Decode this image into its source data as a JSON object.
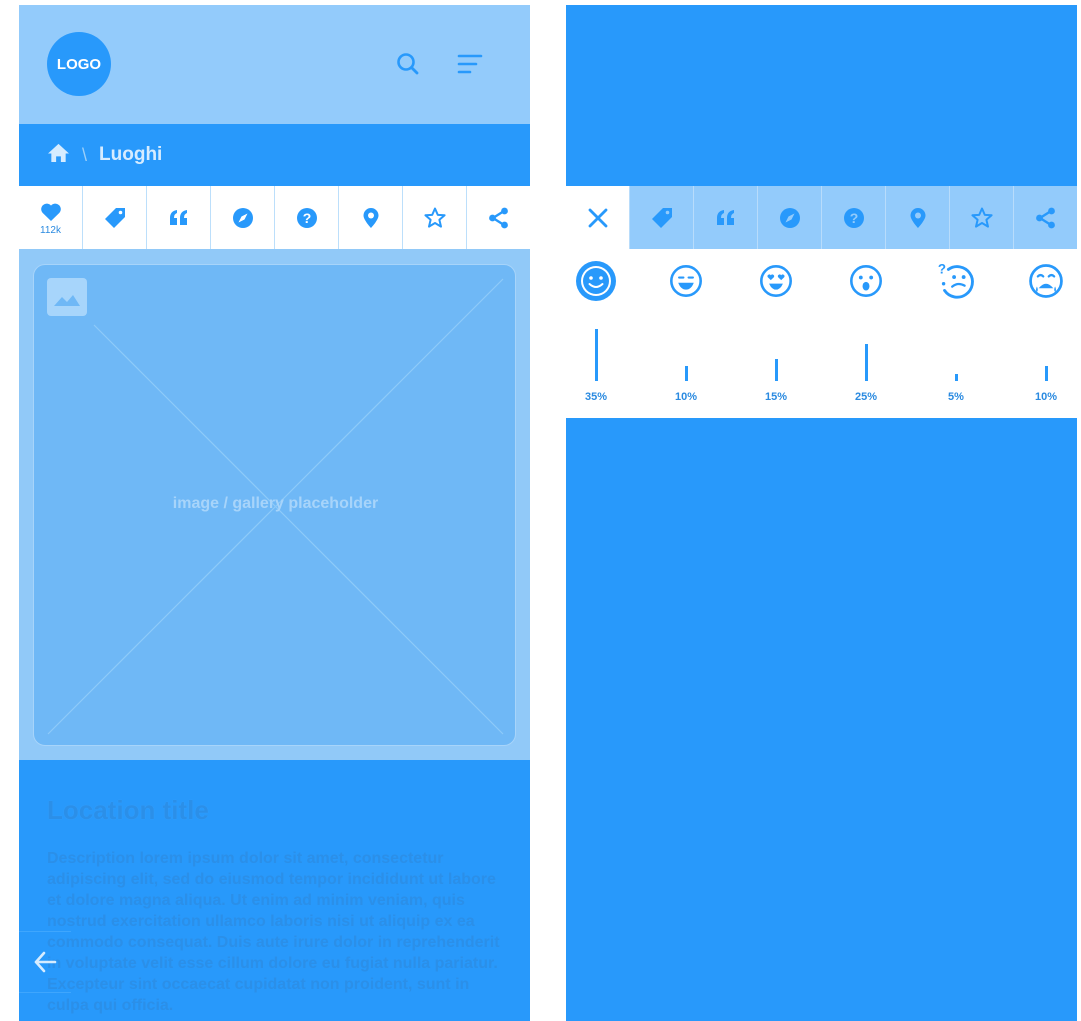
{
  "colors": {
    "brand": "#2899fb",
    "light": "#93cbfb",
    "placeholder": "#6fb8f6",
    "white": "#ffffff"
  },
  "header": {
    "logo_text": "LOGO",
    "icons": [
      "search-icon",
      "menu-icon"
    ]
  },
  "breadcrumb": {
    "home_icon": "home-icon",
    "separator": "\\",
    "current": "Luoghi"
  },
  "tabs": {
    "items": [
      {
        "icon": "heart-icon",
        "count": "112k"
      },
      {
        "icon": "tag-icon"
      },
      {
        "icon": "quote-icon"
      },
      {
        "icon": "compass-icon"
      },
      {
        "icon": "question-icon"
      },
      {
        "icon": "location-pin-icon"
      },
      {
        "icon": "star-icon"
      },
      {
        "icon": "share-icon"
      }
    ]
  },
  "gallery": {
    "label": "image / gallery placeholder",
    "icon": "image-icon"
  },
  "location": {
    "title": "Location title",
    "description": "Description lorem ipsum dolor sit amet, consectetur adipiscing elit, sed do eiusmod tempor incididunt ut labore et dolore magna aliqua. Ut enim ad minim veniam, quis nostrud exercitation ullamco laboris nisi ut aliquip ex ea commodo consequat. Duis aute irure dolor in reprehenderit in voluptate velit esse cillum dolore eu fugiat nulla pariatur. Excepteur sint occaecat cupidatat non proident, sunt in culpa qui officia."
  },
  "back_button": {
    "icon": "arrow-left-icon"
  },
  "reactions_panel": {
    "tabs": [
      "close-icon",
      "tag-icon",
      "quote-icon",
      "compass-icon",
      "question-icon",
      "location-pin-icon",
      "star-icon",
      "share-icon"
    ],
    "reactions": [
      {
        "icon": "smile-icon",
        "percent": "35%",
        "value": 35,
        "selected": true
      },
      {
        "icon": "grin-icon",
        "percent": "10%",
        "value": 10
      },
      {
        "icon": "heart-eyes-icon",
        "percent": "15%",
        "value": 15
      },
      {
        "icon": "surprised-icon",
        "percent": "25%",
        "value": 25
      },
      {
        "icon": "confused-icon",
        "percent": "5%",
        "value": 5
      },
      {
        "icon": "crying-icon",
        "percent": "10%",
        "value": 10
      }
    ]
  }
}
